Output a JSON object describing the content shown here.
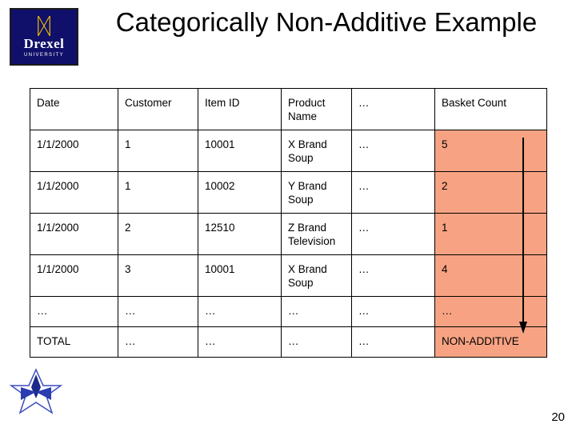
{
  "slide": {
    "title": "Categorically Non-Additive Example",
    "page_number": "20"
  },
  "logo": {
    "dragon_glyph": "ᛞ",
    "wordmark": "Drexel",
    "subtext": "UNIVERSITY"
  },
  "table": {
    "headers": [
      "Date",
      "Customer",
      "Item ID",
      "Product Name",
      "…",
      "Basket Count"
    ],
    "rows": [
      [
        "1/1/2000",
        "1",
        "10001",
        "X Brand Soup",
        "…",
        "5"
      ],
      [
        "1/1/2000",
        "1",
        "10002",
        "Y Brand Soup",
        "…",
        "2"
      ],
      [
        "1/1/2000",
        "2",
        "12510",
        "Z Brand Television",
        "…",
        "1"
      ],
      [
        "1/1/2000",
        "3",
        "10001",
        "X Brand Soup",
        "…",
        "4"
      ],
      [
        "…",
        "…",
        "…",
        "…",
        "…",
        "…"
      ],
      [
        "TOTAL",
        "…",
        "…",
        "…",
        "…",
        "NON-ADDITIVE"
      ]
    ],
    "highlight_color": "#f7a383"
  }
}
